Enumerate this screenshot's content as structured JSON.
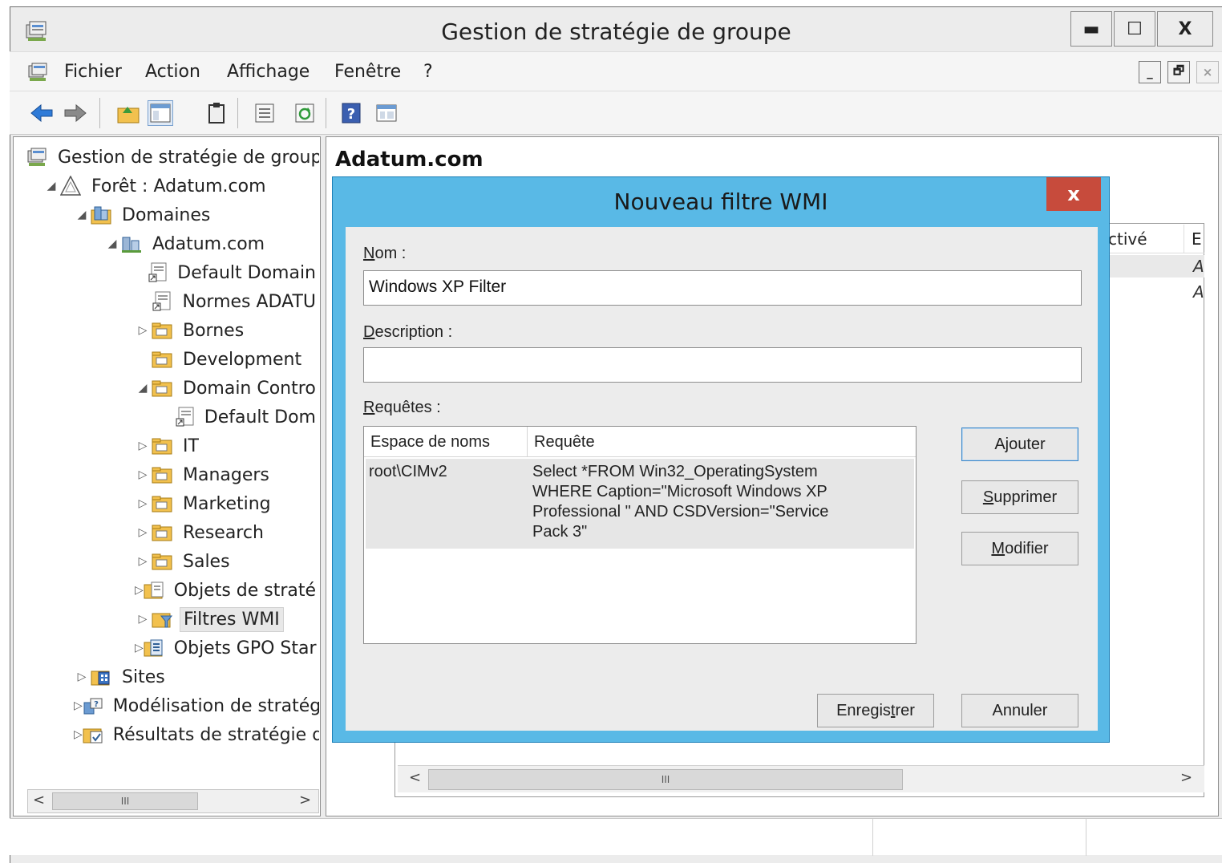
{
  "window": {
    "title": "Gestion de stratégie de groupe",
    "buttons": {
      "minimize": "▬",
      "maximize": "☐",
      "close": "X"
    }
  },
  "menu": {
    "items": [
      "Fichier",
      "Action",
      "Affichage",
      "Fenêtre",
      "?"
    ],
    "mdi": {
      "minimize": "_",
      "restore": "🗗",
      "close": "×"
    }
  },
  "toolbar": {
    "icons": [
      "back-icon",
      "forward-icon",
      "up-folder-icon",
      "show-hide-tree-icon",
      "clipboard-icon",
      "properties-icon",
      "refresh-icon",
      "help-icon",
      "console-icon"
    ]
  },
  "tree": {
    "items": [
      {
        "label": "Gestion de stratégie de groupe",
        "expander": "",
        "icon": "gpmc-icon"
      },
      {
        "label": "Forêt : Adatum.com",
        "expander": "◢",
        "icon": "forest-icon"
      },
      {
        "label": "Domaines",
        "expander": "◢",
        "icon": "domains-icon"
      },
      {
        "label": "Adatum.com",
        "expander": "◢",
        "icon": "domain-icon"
      },
      {
        "label": "Default Domain",
        "expander": "",
        "icon": "gpo-link-icon"
      },
      {
        "label": "Normes ADATU",
        "expander": "",
        "icon": "gpo-link-icon"
      },
      {
        "label": "Bornes",
        "expander": "▷",
        "icon": "ou-icon"
      },
      {
        "label": "Development",
        "expander": "",
        "icon": "ou-icon"
      },
      {
        "label": "Domain Contro",
        "expander": "◢",
        "icon": "ou-icon"
      },
      {
        "label": "Default Dom",
        "expander": "",
        "icon": "gpo-link-icon"
      },
      {
        "label": "IT",
        "expander": "▷",
        "icon": "ou-icon"
      },
      {
        "label": "Managers",
        "expander": "▷",
        "icon": "ou-icon"
      },
      {
        "label": "Marketing",
        "expander": "▷",
        "icon": "ou-icon"
      },
      {
        "label": "Research",
        "expander": "▷",
        "icon": "ou-icon"
      },
      {
        "label": "Sales",
        "expander": "▷",
        "icon": "ou-icon"
      },
      {
        "label": "Objets de straté",
        "expander": "▷",
        "icon": "gpo-folder-icon"
      },
      {
        "label": "Filtres WMI",
        "expander": "▷",
        "icon": "wmi-folder-icon"
      },
      {
        "label": "Objets GPO Star",
        "expander": "▷",
        "icon": "starter-gpo-icon"
      },
      {
        "label": "Sites",
        "expander": "▷",
        "icon": "sites-icon"
      },
      {
        "label": "Modélisation de stratég",
        "expander": "▷",
        "icon": "modeling-icon"
      },
      {
        "label": "Résultats de stratégie d",
        "expander": "▷",
        "icon": "results-icon"
      }
    ],
    "scroll_left": "<",
    "scroll_thumb": "III",
    "scroll_right": ">"
  },
  "right": {
    "title": "Adatum.com",
    "col_header_partial": "ctivé",
    "col_header_e": "E",
    "row_a1": "A",
    "row_a2": "A",
    "scroll_left": "<",
    "scroll_thumb": "III",
    "scroll_right": ">"
  },
  "dialog": {
    "title": "Nouveau filtre WMI",
    "close": "x",
    "name_label_u": "N",
    "name_label_rest": "om :",
    "name_value": "Windows XP Filter",
    "desc_label_u": "D",
    "desc_label_rest": "escription :",
    "desc_value": "",
    "queries_label_u": "R",
    "queries_label_rest": "equêtes :",
    "columns": [
      "Espace de noms",
      "Requête"
    ],
    "rows": [
      {
        "namespace": "root\\CIMv2",
        "query_lines": [
          "Select *FROM Win32_OperatingSystem",
          "WHERE Caption=\"Microsoft Windows XP",
          "Professional \" AND CSDVersion=\"Service",
          "Pack 3\""
        ]
      }
    ],
    "buttons": {
      "add": "Ajouter",
      "remove_u": "S",
      "remove_rest": "upprimer",
      "modify_u": "M",
      "modify_rest": "odifier",
      "save_a": "Enregis",
      "save_u": "t",
      "save_b": "rer",
      "cancel": "Annuler"
    }
  }
}
